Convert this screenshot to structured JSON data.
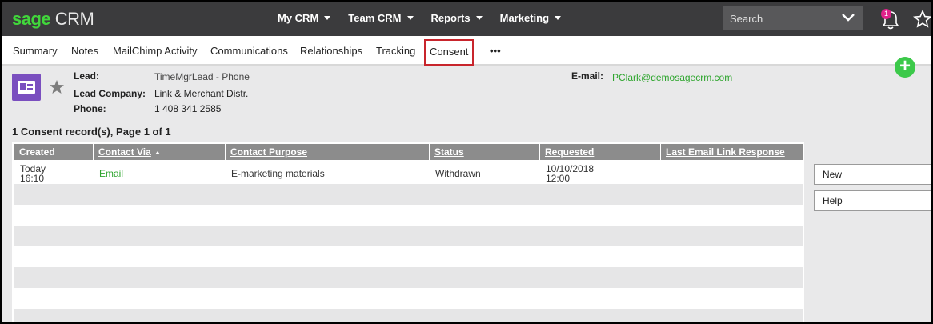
{
  "header": {
    "logo_sage": "sage",
    "logo_crm": " CRM",
    "nav": [
      {
        "label": "My CRM"
      },
      {
        "label": "Team CRM"
      },
      {
        "label": "Reports"
      },
      {
        "label": "Marketing"
      }
    ],
    "search_placeholder": "Search",
    "notification_count": "1"
  },
  "tabs": [
    {
      "label": "Summary"
    },
    {
      "label": "Notes"
    },
    {
      "label": "MailChimp Activity"
    },
    {
      "label": "Communications"
    },
    {
      "label": "Relationships"
    },
    {
      "label": "Tracking"
    },
    {
      "label": "Consent",
      "active": true
    }
  ],
  "more_label": "•••",
  "add_label": "+",
  "lead": {
    "lead_label": "Lead:",
    "lead_value": "TimeMgrLead - Phone",
    "company_label": "Lead Company:",
    "company_value": "Link & Merchant Distr.",
    "phone_label": "Phone:",
    "phone_value": "1 408 341 2585",
    "email_label": "E-mail:",
    "email_value": "PClark@demosagecrm.com"
  },
  "records_summary": "1 Consent record(s), Page 1 of 1",
  "grid": {
    "columns": [
      "Created",
      "Contact Via",
      "Contact Purpose",
      "Status",
      "Requested",
      "Last Email Link Response"
    ],
    "rows": [
      {
        "created_date": "Today",
        "created_time": "16:10",
        "contact_via": "Email",
        "contact_purpose": "E-marketing materials",
        "status": "Withdrawn",
        "requested_date": "10/10/2018",
        "requested_time": "12:00",
        "last_response": ""
      }
    ]
  },
  "actions": {
    "new_label": "New",
    "help_label": "Help"
  },
  "colors": {
    "topbar": "#3b3b3d",
    "brand_green": "#41d63b",
    "link_green": "#2ea52e",
    "active_tab_border": "#c8252c",
    "lead_icon": "#7a4fbf",
    "grid_header": "#8c8c8c"
  }
}
